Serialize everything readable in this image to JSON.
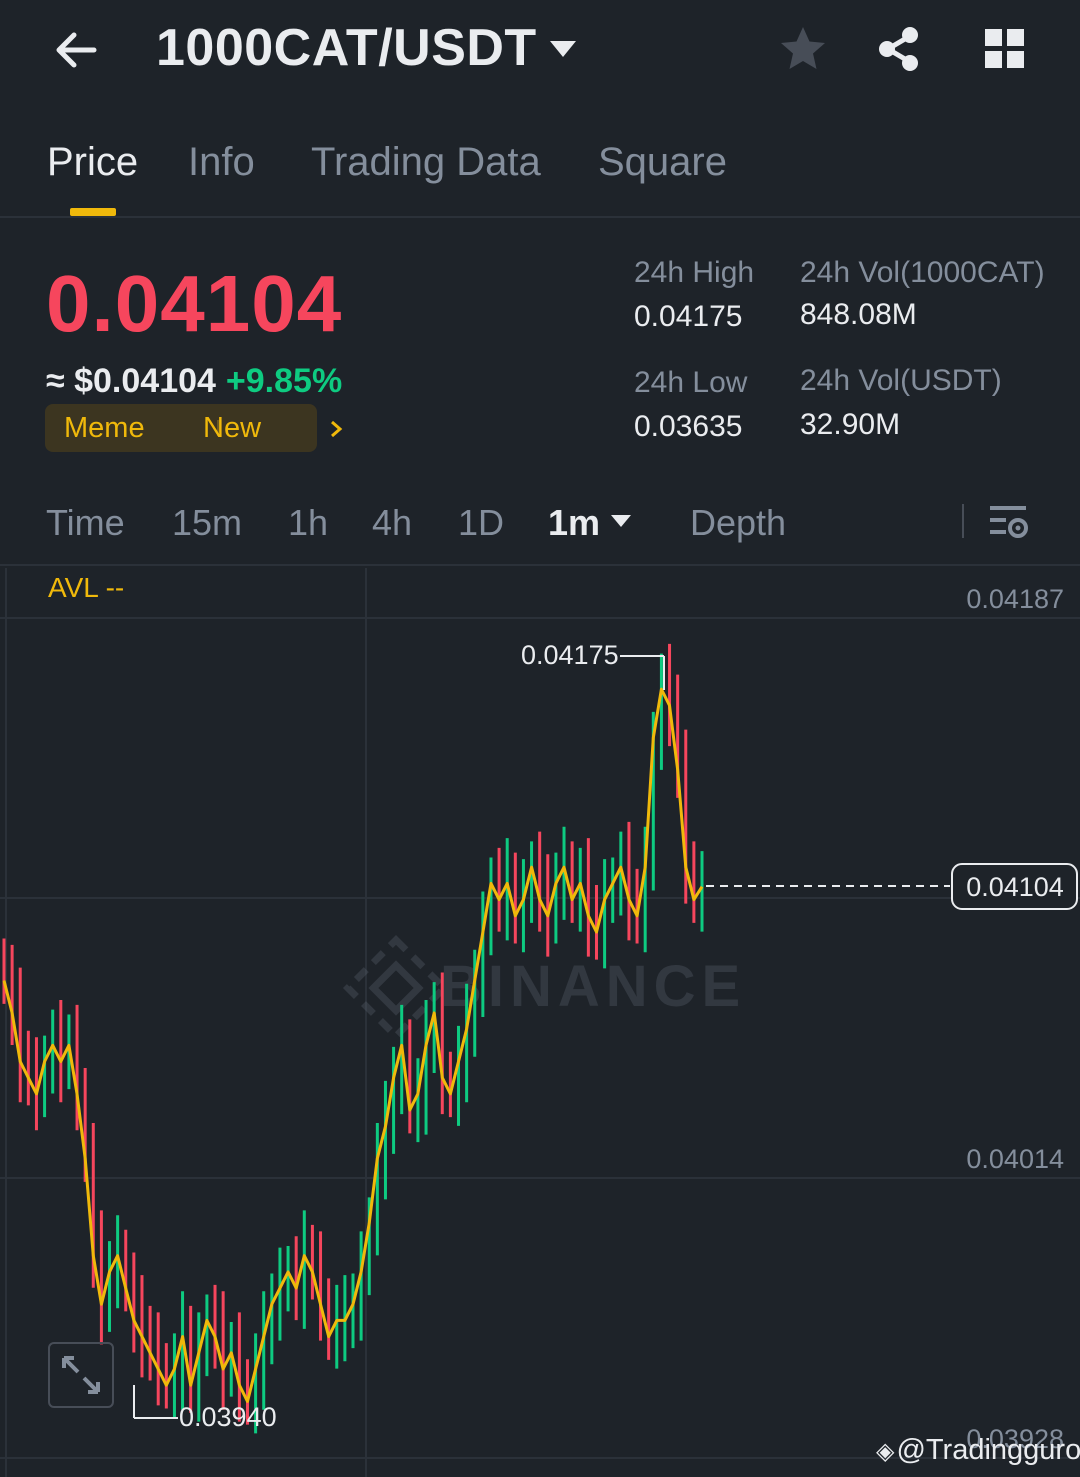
{
  "header": {
    "pair": "1000CAT/USDT",
    "icons": [
      "back-arrow-icon",
      "dropdown-caret-icon",
      "star-icon",
      "share-icon",
      "grid-icon"
    ]
  },
  "tabs": [
    {
      "label": "Price",
      "active": true
    },
    {
      "label": "Info",
      "active": false
    },
    {
      "label": "Trading Data",
      "active": false
    },
    {
      "label": "Square",
      "active": false
    }
  ],
  "ticker": {
    "last_price": "0.04104",
    "usd_price": "≈ $0.04104",
    "change": "+9.85%",
    "tags": [
      "Meme",
      "New"
    ],
    "high_label": "24h High",
    "high_value": "0.04175",
    "low_label": "24h Low",
    "low_value": "0.03635",
    "vol_base_label": "24h Vol(1000CAT)",
    "vol_base_value": "848.08M",
    "vol_quote_label": "24h Vol(USDT)",
    "vol_quote_value": "32.90M"
  },
  "intervals": {
    "items": [
      "Time",
      "15m",
      "1h",
      "4h",
      "1D",
      "1m",
      "Depth"
    ],
    "active": "1m"
  },
  "chart": {
    "avl_label": "AVL --",
    "watermark": "BINANCE",
    "axis_labels": [
      "0.04187",
      "0.04014",
      "0.03928"
    ],
    "max_marker": "0.04175",
    "min_marker": "0.03940",
    "current_price_tag": "0.04104",
    "credit": "@Tradingguro"
  },
  "colors": {
    "bg": "#1e2329",
    "up": "#0ecb81",
    "down": "#f6465d",
    "accent": "#f0b90b",
    "muted": "#848e9c"
  },
  "chart_data": {
    "type": "candlestick",
    "interval": "1m",
    "price_range": [
      0.0392,
      0.0419
    ],
    "y_ticks": [
      0.04187,
      0.04014,
      0.03928
    ],
    "last_price": 0.04104,
    "high_marker": 0.04175,
    "low_marker": 0.0394,
    "close_line_approx": [
      0.04075,
      0.04065,
      0.0405,
      0.04045,
      0.0404,
      0.0405,
      0.04055,
      0.0405,
      0.04055,
      0.0404,
      0.0402,
      0.0399,
      0.03975,
      0.03985,
      0.0399,
      0.0398,
      0.0397,
      0.03965,
      0.0396,
      0.03955,
      0.0395,
      0.03955,
      0.03965,
      0.0395,
      0.0396,
      0.0397,
      0.03965,
      0.03955,
      0.0396,
      0.0395,
      0.03945,
      0.03955,
      0.03965,
      0.03975,
      0.0398,
      0.03985,
      0.0398,
      0.0399,
      0.03985,
      0.03975,
      0.03965,
      0.0397,
      0.0397,
      0.03975,
      0.03985,
      0.04,
      0.0402,
      0.0403,
      0.04045,
      0.04055,
      0.04035,
      0.0404,
      0.04055,
      0.04065,
      0.04045,
      0.0404,
      0.0405,
      0.0406,
      0.04075,
      0.0409,
      0.04105,
      0.041,
      0.04105,
      0.04095,
      0.041,
      0.0411,
      0.041,
      0.04095,
      0.04105,
      0.0411,
      0.041,
      0.04105,
      0.04095,
      0.0409,
      0.041,
      0.04105,
      0.0411,
      0.041,
      0.04095,
      0.0411,
      0.0415,
      0.04165,
      0.0416,
      0.0414,
      0.0411,
      0.041,
      0.04104
    ]
  }
}
